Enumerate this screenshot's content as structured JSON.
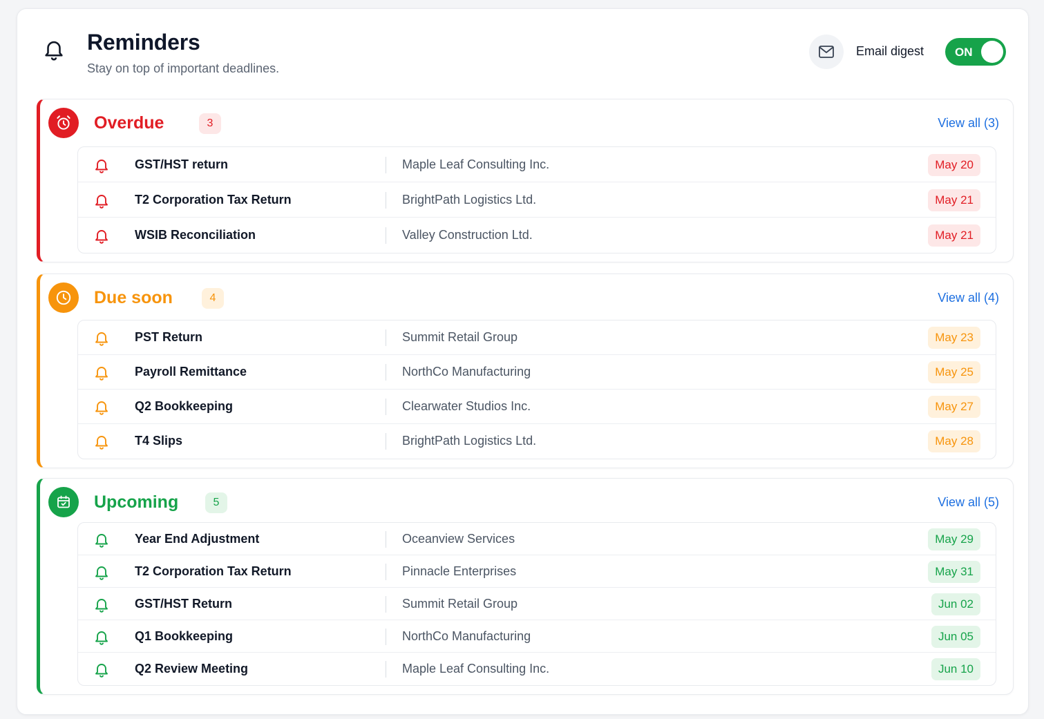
{
  "header": {
    "title": "Reminders",
    "subtitle": "Stay on top of important deadlines.",
    "email_digest_label": "Email digest",
    "toggle_label": "ON"
  },
  "colors": {
    "overdue": "#e11d24",
    "due_soon": "#f7940c",
    "upcoming": "#16a34a",
    "link": "#1d6fe0"
  },
  "sections": [
    {
      "key": "overdue",
      "title": "Overdue",
      "count": "3",
      "view_all": "View all (3)",
      "icon": "alarm-clock-icon",
      "items": [
        {
          "name": "GST/HST return",
          "client": "Maple Leaf Consulting Inc.",
          "date": "May 20"
        },
        {
          "name": "T2 Corporation Tax Return",
          "client": "BrightPath Logistics Ltd.",
          "date": "May 21"
        },
        {
          "name": "WSIB Reconciliation",
          "client": "Valley Construction Ltd.",
          "date": "May 21"
        }
      ]
    },
    {
      "key": "due_soon",
      "title": "Due soon",
      "count": "4",
      "view_all": "View all (4)",
      "icon": "clock-icon",
      "items": [
        {
          "name": "PST Return",
          "client": "Summit Retail Group",
          "date": "May 23"
        },
        {
          "name": "Payroll Remittance",
          "client": "NorthCo Manufacturing",
          "date": "May 25"
        },
        {
          "name": "Q2 Bookkeeping",
          "client": "Clearwater Studios Inc.",
          "date": "May 27"
        },
        {
          "name": "T4 Slips",
          "client": "BrightPath Logistics Ltd.",
          "date": "May 28"
        }
      ]
    },
    {
      "key": "upcoming",
      "title": "Upcoming",
      "count": "5",
      "view_all": "View all (5)",
      "icon": "calendar-icon",
      "items": [
        {
          "name": "Year End Adjustment",
          "client": "Oceanview Services",
          "date": "May 29"
        },
        {
          "name": "T2 Corporation Tax Return",
          "client": "Pinnacle Enterprises",
          "date": "May 31"
        },
        {
          "name": "GST/HST Return",
          "client": "Summit Retail Group",
          "date": "Jun 02"
        },
        {
          "name": "Q1 Bookkeeping",
          "client": "NorthCo Manufacturing",
          "date": "Jun 05"
        },
        {
          "name": "Q2 Review Meeting",
          "client": "Maple Leaf Consulting Inc.",
          "date": "Jun 10"
        }
      ]
    }
  ]
}
